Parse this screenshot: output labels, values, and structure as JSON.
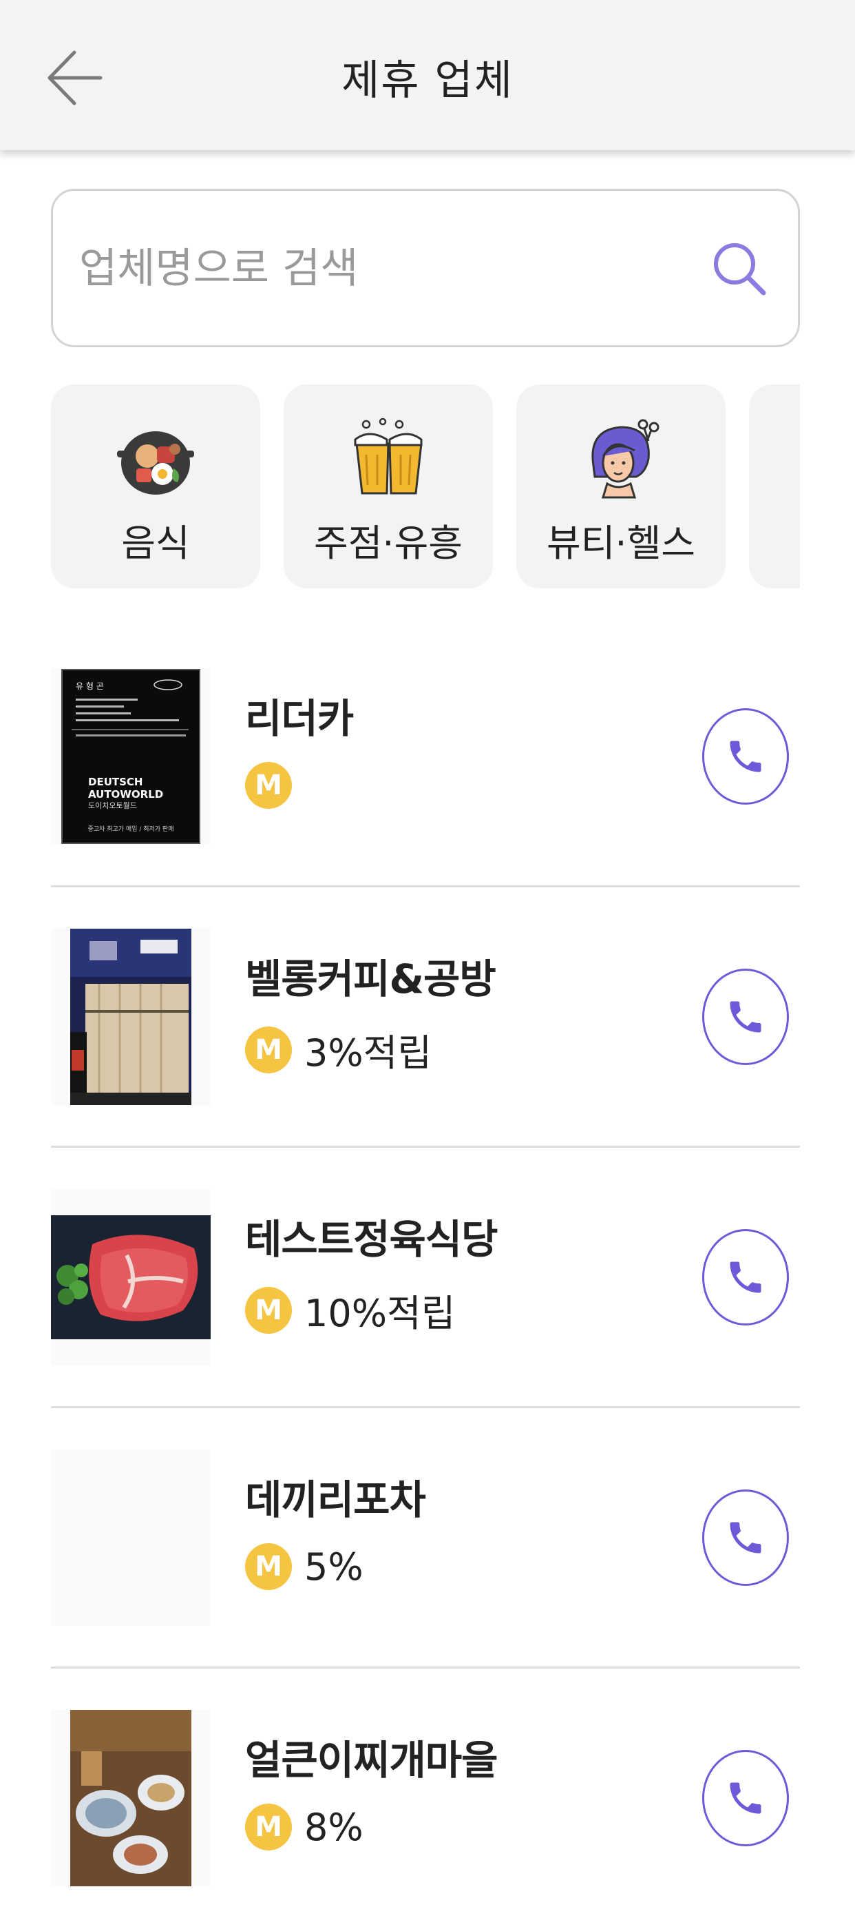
{
  "header": {
    "title": "제휴 업체",
    "back_icon": "arrow-left-icon"
  },
  "search": {
    "placeholder": "업체명으로 검색",
    "value": "",
    "icon": "search-icon"
  },
  "categories": [
    {
      "label": "음식",
      "icon": "food-pan-icon"
    },
    {
      "label": "주점·유흥",
      "icon": "beer-mugs-icon"
    },
    {
      "label": "뷰티·헬스",
      "icon": "hair-salon-icon"
    },
    {
      "label": "",
      "icon": ""
    }
  ],
  "businesses": [
    {
      "name": "리더카",
      "badge": "M",
      "reward": "",
      "thumb": "black-flyer",
      "thumb_text": {
        "owner": "유 형 곤",
        "line1": "DEUTSCH",
        "line2": "AUTOWORLD",
        "line3": "도이치오토월드",
        "footer": "중고차 최고가 매입 / 최저가 판매"
      }
    },
    {
      "name": "벨롱커피&공방",
      "badge": "M",
      "reward": "3%적립",
      "thumb": "storefront-night"
    },
    {
      "name": "테스트정육식당",
      "badge": "M",
      "reward": "10%적립",
      "thumb": "raw-steak"
    },
    {
      "name": "데끼리포차",
      "badge": "M",
      "reward": "5%",
      "thumb": "blank"
    },
    {
      "name": "얼큰이찌개마을",
      "badge": "M",
      "reward": "8%",
      "thumb": "food-table"
    }
  ],
  "colors": {
    "accent": "#6e59d8",
    "badge": "#f5c542",
    "header_bg": "#f2f3f3",
    "divider": "#dcdcdc"
  }
}
